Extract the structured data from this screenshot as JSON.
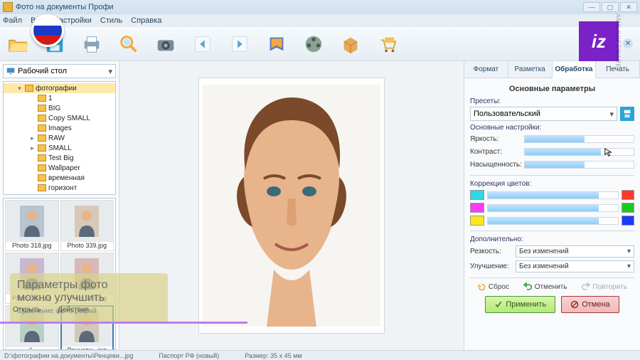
{
  "window": {
    "title": "Фото на документы Профи"
  },
  "menu": {
    "file": "Файл",
    "view": "Вид",
    "settings": "Настройки",
    "style": "Стиль",
    "help": "Справка"
  },
  "toolbar_icons": {
    "open": "open-folder-icon",
    "save": "save-icon",
    "print": "print-icon",
    "zoom": "magnifier-icon",
    "camera": "camera-icon",
    "prev": "prev-icon",
    "next": "next-icon",
    "guide": "guide-icon",
    "reel": "reel-icon",
    "package": "package-icon",
    "cart": "cart-icon"
  },
  "left": {
    "folder_selected": "Рабочий стол",
    "tree": [
      {
        "label": "фотографии",
        "expanded": true,
        "selected": true,
        "depth": 1
      },
      {
        "label": "1",
        "depth": 2
      },
      {
        "label": "BIG",
        "depth": 2
      },
      {
        "label": "Copy SMALL",
        "depth": 2
      },
      {
        "label": "Images",
        "depth": 2
      },
      {
        "label": "RAW",
        "expandable": true,
        "depth": 2
      },
      {
        "label": "SMALL",
        "expandable": true,
        "depth": 2
      },
      {
        "label": "Test Big",
        "depth": 2
      },
      {
        "label": "Wallpaper",
        "depth": 2
      },
      {
        "label": "временная",
        "depth": 2
      },
      {
        "label": "горизонт",
        "depth": 2
      }
    ],
    "thumbs": [
      {
        "label": "Photo 318.jpg"
      },
      {
        "label": "Photo 339.jpg"
      },
      {
        "label": "Photo 344.jpg"
      },
      {
        "label": "Photo 399.jpg"
      },
      {
        "label": "горбун..."
      },
      {
        "label": "Ренцеви...jpg",
        "selected": true
      }
    ]
  },
  "overlay": {
    "line1": "Параметры фото",
    "line2": "можно улучшить",
    "line3": "Сравнение фотографий",
    "open": "Открыть",
    "actions": "Действия"
  },
  "right": {
    "tabs": {
      "format": "Формат",
      "markup": "Разметка",
      "processing": "Обработка",
      "print": "Печать",
      "active": "Обработка"
    },
    "title": "Основные параметры",
    "presets_label": "Пресеты:",
    "preset_selected": "Пользовательский",
    "basic_label": "Основные настройки:",
    "sliders": {
      "brightness": {
        "label": "Яркость:",
        "value": 55
      },
      "contrast": {
        "label": "Контраст:",
        "value": 70
      },
      "saturation": {
        "label": "Насыщенность:",
        "value": 55
      }
    },
    "cc_label": "Коррекция цветов:",
    "cc_rows": [
      {
        "left": "#2fd6e3",
        "right": "#ff3a2a",
        "value": 85
      },
      {
        "left": "#ff3af2",
        "right": "#1acc1a",
        "value": 85
      },
      {
        "left": "#ffe81a",
        "right": "#1a3aff",
        "value": 85
      }
    ],
    "extra_label": "Дополнительно:",
    "sharp_label": "Резкость:",
    "enhance_label": "Улучшение:",
    "no_change": "Без изменений",
    "reset": "Сброс",
    "undo": "Отменить",
    "redo": "Повторить",
    "apply": "Применить",
    "cancel": "Отмена"
  },
  "status": {
    "file": "D:\\фотографии на документы\\Ренцеви...jpg",
    "passport": "Паспорт РФ (новый)",
    "size": "Размер: 35 x 45 мм"
  },
  "watermark": "AMS SOFTWARE"
}
